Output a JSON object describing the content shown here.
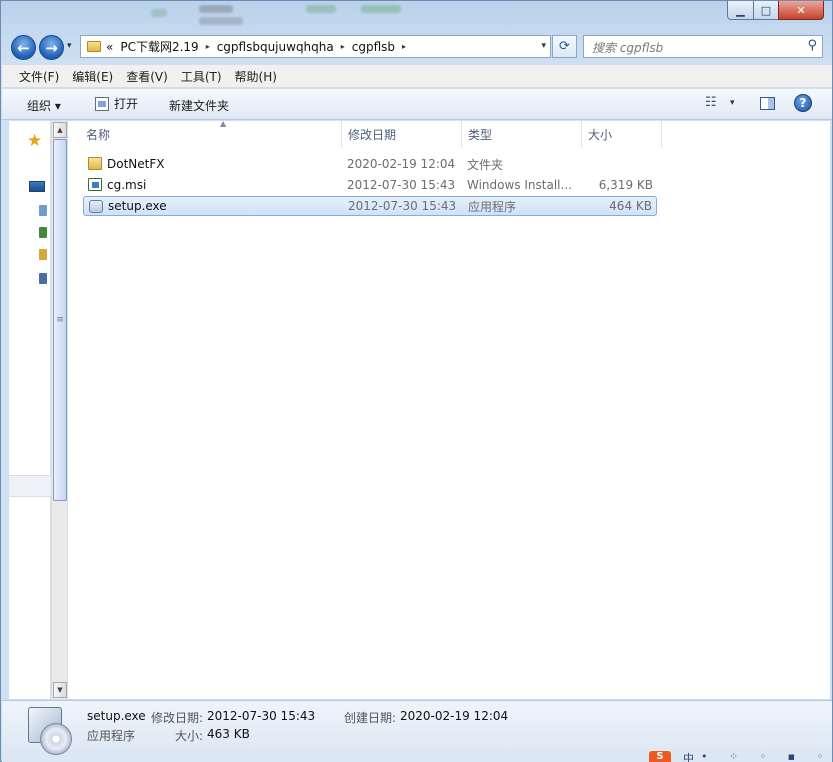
{
  "window": {
    "controls": {
      "minimize": "▁",
      "maximize": "□",
      "close": "✕"
    }
  },
  "navigation": {
    "back_glyph": "←",
    "forward_glyph": "→",
    "history_glyph": "▾",
    "breadcrumb": [
      "«",
      "PC下载网2.19",
      "cgpflsbqujuwqhqha",
      "cgpflsb"
    ],
    "breadcrumb_separator": "▸",
    "address_dropdown_glyph": "▾",
    "refresh_glyph": "⟳",
    "search_placeholder": "搜索 cgpflsb",
    "search_icon": "search-icon"
  },
  "menu": {
    "items": [
      "文件(F)",
      "编辑(E)",
      "查看(V)",
      "工具(T)",
      "帮助(H)"
    ]
  },
  "toolbar": {
    "organize": "组织 ▾",
    "open": "打开",
    "new_folder": "新建文件夹",
    "views_glyph": "☷",
    "views_drop": "▾",
    "help_glyph": "?"
  },
  "columns": {
    "name": "名称",
    "date": "修改日期",
    "type": "类型",
    "size": "大小",
    "sort_glyph": "▲"
  },
  "files": [
    {
      "name": "DotNetFX",
      "date": "2020-02-19 12:04",
      "type": "文件夹",
      "size": "",
      "icon": "folder-icon"
    },
    {
      "name": "cg.msi",
      "date": "2012-07-30 15:43",
      "type": "Windows Install...",
      "size": "6,319 KB",
      "icon": "msi-icon"
    },
    {
      "name": "setup.exe",
      "date": "2012-07-30 15:43",
      "type": "应用程序",
      "size": "464 KB",
      "icon": "exe-icon",
      "selected": true
    }
  ],
  "details": {
    "name": "setup.exe",
    "modified_label": "修改日期:",
    "modified": "2012-07-30 15:43",
    "created_label": "创建日期:",
    "created": "2020-02-19 12:04",
    "type": "应用程序",
    "size_label": "大小:",
    "size": "463 KB"
  },
  "ime": {
    "logo": "S",
    "mode": "中"
  },
  "colors": {
    "selection": "#cfe2f9",
    "accent": "#1f5fb4"
  }
}
